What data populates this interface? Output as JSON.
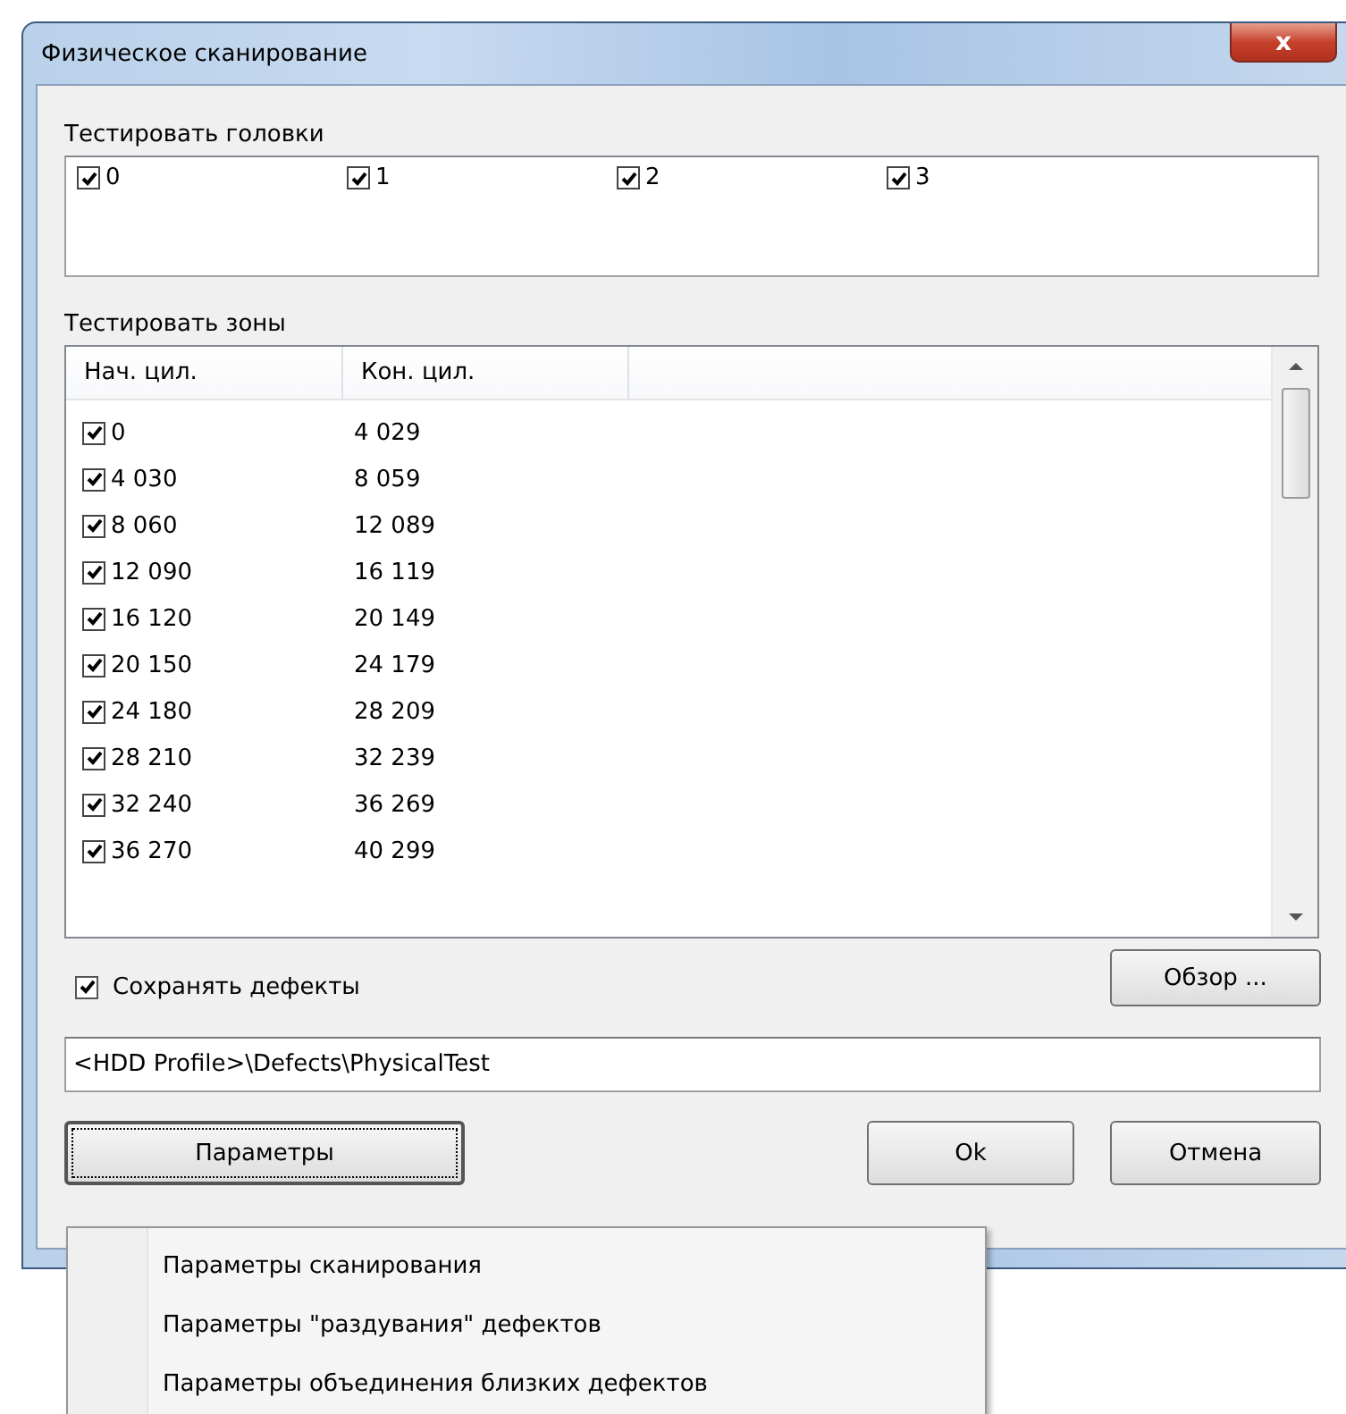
{
  "window": {
    "title": "Физическое сканирование",
    "close": "x"
  },
  "heads": {
    "label": "Тестировать головки",
    "items": [
      {
        "label": "0",
        "checked": true
      },
      {
        "label": "1",
        "checked": true
      },
      {
        "label": "2",
        "checked": true
      },
      {
        "label": "3",
        "checked": true
      }
    ]
  },
  "zones": {
    "label": "Тестировать зоны",
    "columns": [
      "Нач. цил.",
      "Кон. цил."
    ],
    "rows": [
      {
        "start": "0",
        "end": "4 029",
        "checked": true
      },
      {
        "start": "4 030",
        "end": "8 059",
        "checked": true
      },
      {
        "start": "8 060",
        "end": "12 089",
        "checked": true
      },
      {
        "start": "12 090",
        "end": "16 119",
        "checked": true
      },
      {
        "start": "16 120",
        "end": "20 149",
        "checked": true
      },
      {
        "start": "20 150",
        "end": "24 179",
        "checked": true
      },
      {
        "start": "24 180",
        "end": "28 209",
        "checked": true
      },
      {
        "start": "28 210",
        "end": "32 239",
        "checked": true
      },
      {
        "start": "32 240",
        "end": "36 269",
        "checked": true
      },
      {
        "start": "36 270",
        "end": "40 299",
        "checked": true
      }
    ]
  },
  "save_defects": {
    "label": "Сохранять дефекты",
    "checked": true
  },
  "browse_button": "Обзор ...",
  "path_field": {
    "value": "<HDD Profile>\\Defects\\PhysicalTest"
  },
  "buttons": {
    "params": "Параметры",
    "ok": "Ok",
    "cancel": "Отмена"
  },
  "params_menu": [
    "Параметры сканирования",
    "Параметры \"раздувания\" дефектов",
    "Параметры объединения близких дефектов"
  ]
}
